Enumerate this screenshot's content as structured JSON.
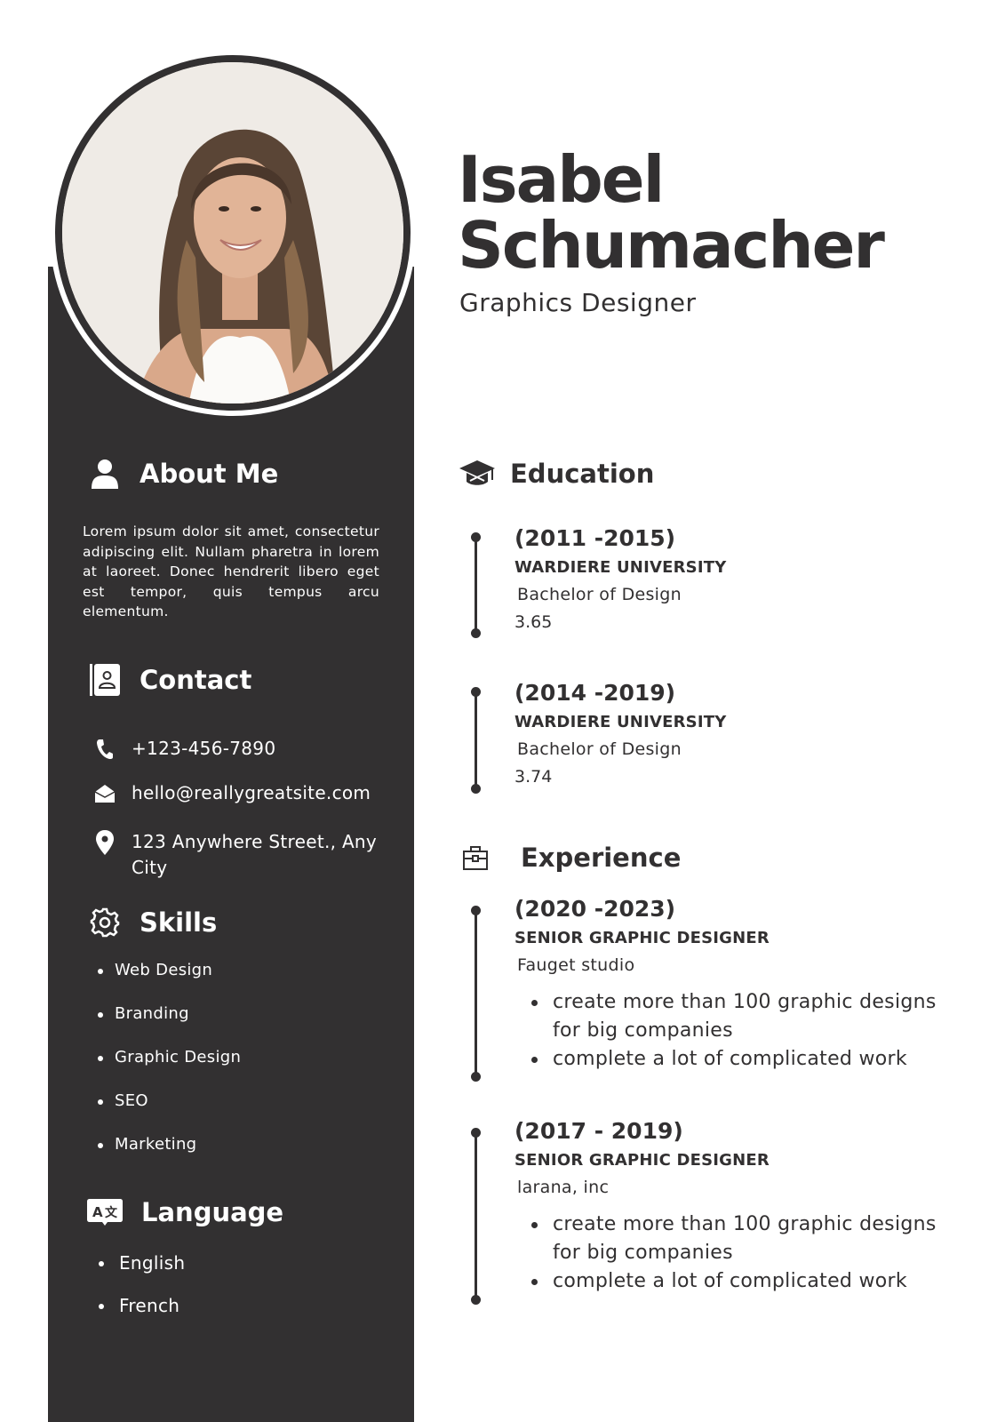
{
  "header": {
    "first_name": "Isabel",
    "last_name": "Schumacher",
    "job_title": "Graphics Designer",
    "photo": "portrait-photo-smiling-woman"
  },
  "colors": {
    "dark": "#323031",
    "light": "#ffffff"
  },
  "sidebar": {
    "about": {
      "icon": "user-icon",
      "heading": "About Me",
      "text": "Lorem ipsum dolor sit amet, consectetur adipiscing elit. Nullam pharetra in lorem at laoreet. Donec hendrerit libero eget est tempor, quis tempus arcu elementum."
    },
    "contact": {
      "icon": "address-book-icon",
      "heading": "Contact",
      "items": [
        {
          "icon": "phone-icon",
          "value": "+123-456-7890"
        },
        {
          "icon": "envelope-open-icon",
          "value": "hello@reallygreatsite.com"
        },
        {
          "icon": "map-pin-icon",
          "value": "123 Anywhere Street., Any City"
        }
      ]
    },
    "skills": {
      "icon": "gear-icon",
      "heading": "Skills",
      "items": [
        "Web Design",
        "Branding",
        "Graphic Design",
        "SEO",
        "Marketing"
      ]
    },
    "language": {
      "icon": "translate-icon",
      "heading": "Language",
      "items": [
        "English",
        "French"
      ]
    }
  },
  "main": {
    "education": {
      "icon": "graduation-cap-icon",
      "heading": "Education",
      "entries": [
        {
          "period": "(2011 -2015)",
          "school": "WARDIERE UNIVERSITY",
          "degree": "Bachelor of Design",
          "gpa": "3.65"
        },
        {
          "period": "(2014 -2019)",
          "school": "WARDIERE UNIVERSITY",
          "degree": "Bachelor of Design",
          "gpa": "3.74"
        }
      ]
    },
    "experience": {
      "icon": "briefcase-icon",
      "heading": "Experience",
      "entries": [
        {
          "period": "(2020 -2023)",
          "role": "SENIOR GRAPHIC DESIGNER",
          "company": "Fauget studio",
          "bullets": [
            "create more than 100 graphic designs for big companies",
            "complete a lot of complicated work"
          ]
        },
        {
          "period": "(2017 - 2019)",
          "role": "SENIOR GRAPHIC DESIGNER",
          "company": "larana, inc",
          "bullets": [
            "create more than 100 graphic designs for big companies",
            "complete a lot of complicated work"
          ]
        }
      ]
    }
  }
}
